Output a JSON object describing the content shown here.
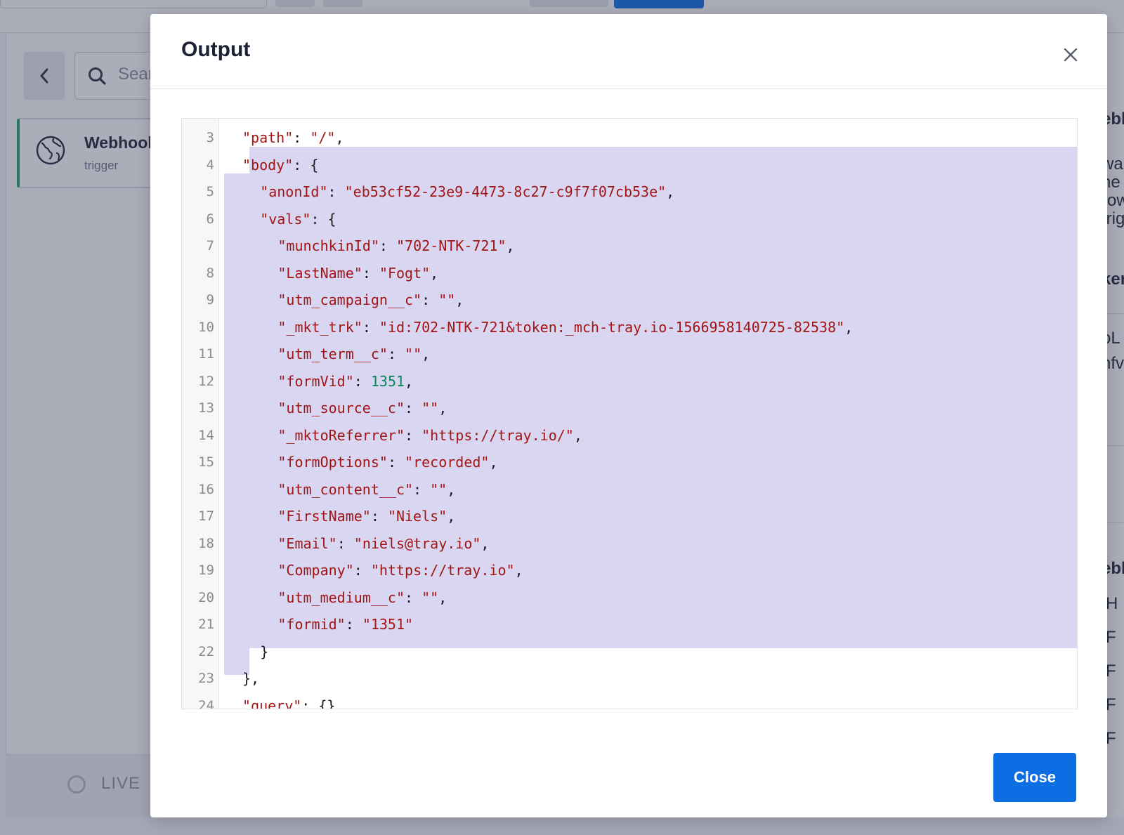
{
  "background": {
    "search_placeholder": "Sear",
    "card": {
      "title": "Webhook",
      "subtitle": "trigger"
    },
    "status": "LIVE",
    "right_fragments": [
      "ebh",
      "wa",
      "ne",
      "row",
      "trig",
      "ker",
      "oL",
      "nfv",
      "ebh",
      "H",
      "F",
      "F",
      "F",
      "F"
    ]
  },
  "modal": {
    "title": "Output",
    "close_button_label": "Close",
    "code_lines": [
      {
        "ln": "3",
        "indent": 2,
        "parts": [
          [
            "k",
            "\"path\""
          ],
          [
            "p",
            ": "
          ],
          [
            "s",
            "\"/\""
          ],
          [
            "p",
            ","
          ]
        ]
      },
      {
        "ln": "4",
        "indent": 2,
        "parts": [
          [
            "k",
            "\"body\""
          ],
          [
            "p",
            ": {"
          ]
        ]
      },
      {
        "ln": "5",
        "indent": 4,
        "parts": [
          [
            "k",
            "\"anonId\""
          ],
          [
            "p",
            ": "
          ],
          [
            "s",
            "\"eb53cf52-23e9-4473-8c27-c9f7f07cb53e\""
          ],
          [
            "p",
            ","
          ]
        ]
      },
      {
        "ln": "6",
        "indent": 4,
        "parts": [
          [
            "k",
            "\"vals\""
          ],
          [
            "p",
            ": {"
          ]
        ]
      },
      {
        "ln": "7",
        "indent": 6,
        "parts": [
          [
            "k",
            "\"munchkinId\""
          ],
          [
            "p",
            ": "
          ],
          [
            "s",
            "\"702-NTK-721\""
          ],
          [
            "p",
            ","
          ]
        ]
      },
      {
        "ln": "8",
        "indent": 6,
        "parts": [
          [
            "k",
            "\"LastName\""
          ],
          [
            "p",
            ": "
          ],
          [
            "s",
            "\"Fogt\""
          ],
          [
            "p",
            ","
          ]
        ]
      },
      {
        "ln": "9",
        "indent": 6,
        "parts": [
          [
            "k",
            "\"utm_campaign__c\""
          ],
          [
            "p",
            ": "
          ],
          [
            "s",
            "\"\""
          ],
          [
            "p",
            ","
          ]
        ]
      },
      {
        "ln": "10",
        "indent": 6,
        "parts": [
          [
            "k",
            "\"_mkt_trk\""
          ],
          [
            "p",
            ": "
          ],
          [
            "s",
            "\"id:702-NTK-721&token:_mch-tray.io-1566958140725-82538\""
          ],
          [
            "p",
            ","
          ]
        ]
      },
      {
        "ln": "11",
        "indent": 6,
        "parts": [
          [
            "k",
            "\"utm_term__c\""
          ],
          [
            "p",
            ": "
          ],
          [
            "s",
            "\"\""
          ],
          [
            "p",
            ","
          ]
        ]
      },
      {
        "ln": "12",
        "indent": 6,
        "parts": [
          [
            "k",
            "\"formVid\""
          ],
          [
            "p",
            ": "
          ],
          [
            "n",
            "1351"
          ],
          [
            "p",
            ","
          ]
        ]
      },
      {
        "ln": "13",
        "indent": 6,
        "parts": [
          [
            "k",
            "\"utm_source__c\""
          ],
          [
            "p",
            ": "
          ],
          [
            "s",
            "\"\""
          ],
          [
            "p",
            ","
          ]
        ]
      },
      {
        "ln": "14",
        "indent": 6,
        "parts": [
          [
            "k",
            "\"_mktoReferrer\""
          ],
          [
            "p",
            ": "
          ],
          [
            "s",
            "\"https://tray.io/\""
          ],
          [
            "p",
            ","
          ]
        ]
      },
      {
        "ln": "15",
        "indent": 6,
        "parts": [
          [
            "k",
            "\"formOptions\""
          ],
          [
            "p",
            ": "
          ],
          [
            "s",
            "\"recorded\""
          ],
          [
            "p",
            ","
          ]
        ]
      },
      {
        "ln": "16",
        "indent": 6,
        "parts": [
          [
            "k",
            "\"utm_content__c\""
          ],
          [
            "p",
            ": "
          ],
          [
            "s",
            "\"\""
          ],
          [
            "p",
            ","
          ]
        ]
      },
      {
        "ln": "17",
        "indent": 6,
        "parts": [
          [
            "k",
            "\"FirstName\""
          ],
          [
            "p",
            ": "
          ],
          [
            "s",
            "\"Niels\""
          ],
          [
            "p",
            ","
          ]
        ]
      },
      {
        "ln": "18",
        "indent": 6,
        "parts": [
          [
            "k",
            "\"Email\""
          ],
          [
            "p",
            ": "
          ],
          [
            "s",
            "\"niels@tray.io\""
          ],
          [
            "p",
            ","
          ]
        ]
      },
      {
        "ln": "19",
        "indent": 6,
        "parts": [
          [
            "k",
            "\"Company\""
          ],
          [
            "p",
            ": "
          ],
          [
            "s",
            "\"https://tray.io\""
          ],
          [
            "p",
            ","
          ]
        ]
      },
      {
        "ln": "20",
        "indent": 6,
        "parts": [
          [
            "k",
            "\"utm_medium__c\""
          ],
          [
            "p",
            ": "
          ],
          [
            "s",
            "\"\""
          ],
          [
            "p",
            ","
          ]
        ]
      },
      {
        "ln": "21",
        "indent": 6,
        "parts": [
          [
            "k",
            "\"formid\""
          ],
          [
            "p",
            ": "
          ],
          [
            "s",
            "\"1351\""
          ]
        ]
      },
      {
        "ln": "22",
        "indent": 4,
        "parts": [
          [
            "p",
            "}"
          ]
        ]
      },
      {
        "ln": "23",
        "indent": 2,
        "parts": [
          [
            "p",
            "},"
          ]
        ]
      },
      {
        "ln": "24",
        "indent": 2,
        "parts": [
          [
            "k",
            "\"query\""
          ],
          [
            "p",
            ": {},"
          ]
        ]
      }
    ]
  }
}
